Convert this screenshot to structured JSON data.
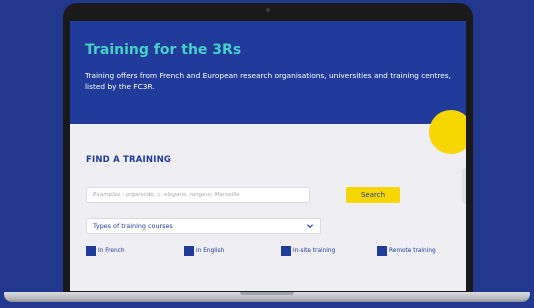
{
  "hero": {
    "title": "Training for the 3Rs",
    "description": "Training offers from French and European research organisations, universities and training centres, listed by the FC3R."
  },
  "search": {
    "section_title": "FIND A TRAINING",
    "placeholder": "Examples : organoïde, c. elegans, rongeur, Marseille",
    "button_label": "Search"
  },
  "filters": {
    "type_select_label": "Types of training courses",
    "checkboxes": [
      {
        "label": "In French"
      },
      {
        "label": "In English"
      },
      {
        "label": "In-site training"
      },
      {
        "label": "Remote training"
      }
    ]
  },
  "colors": {
    "background": "#22388f",
    "hero_bg": "#203b99",
    "hero_title": "#45d1c7",
    "accent_yellow": "#f7d600",
    "navy": "#203b99",
    "content_bg": "#eeeef3"
  },
  "icons": {
    "select_chevron": "chevron-down-icon"
  }
}
